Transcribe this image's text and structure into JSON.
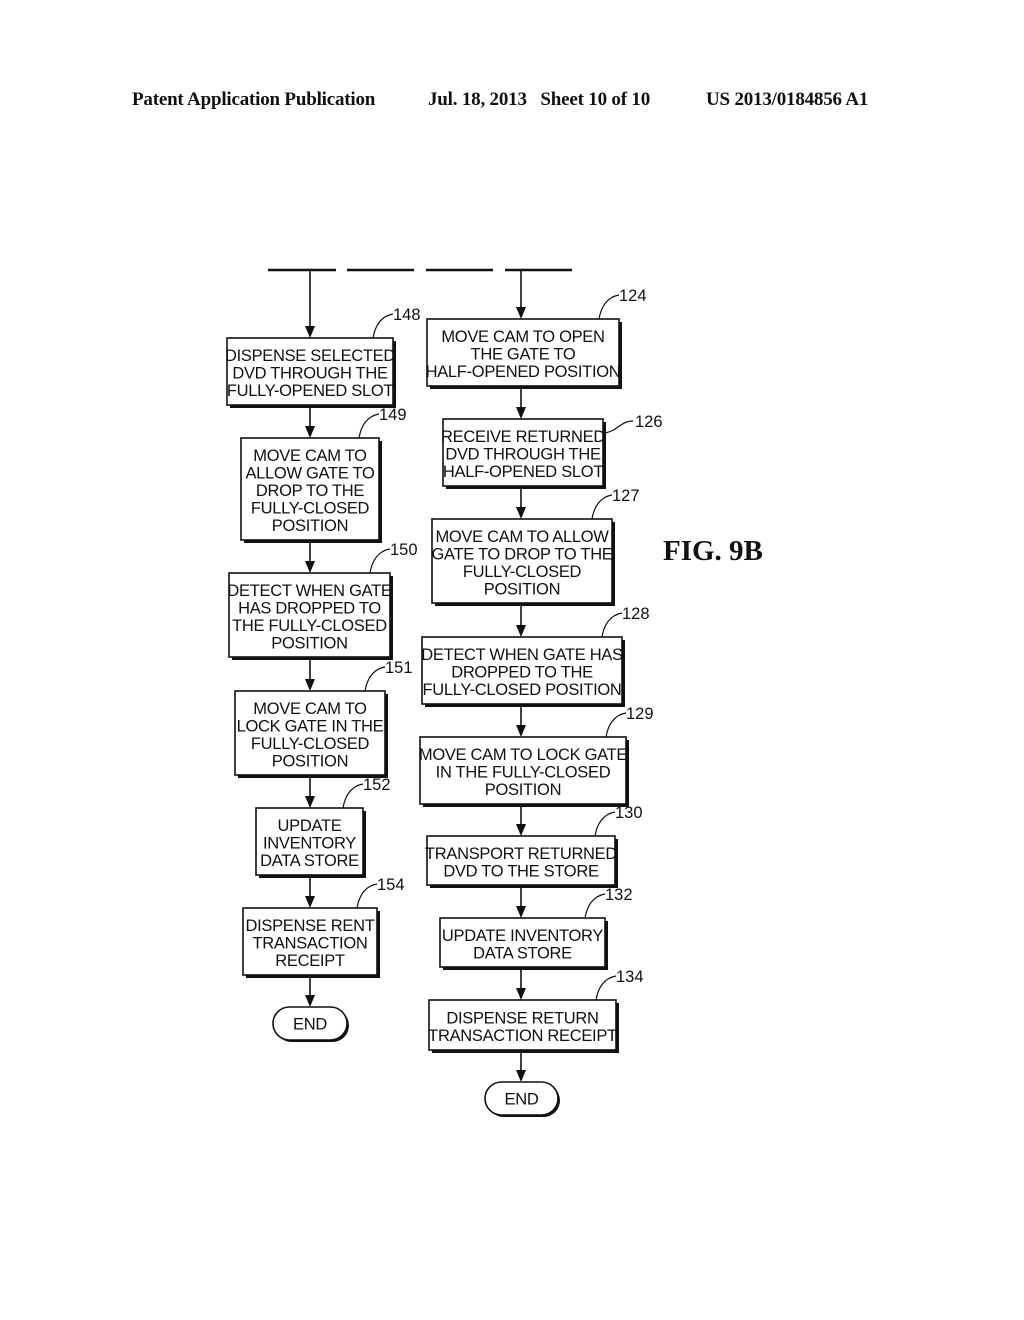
{
  "header": {
    "publication": "Patent Application Publication",
    "date_sheet": "Jul. 18, 2013   Sheet 10 of 10",
    "patent_number": "US 2013/0184856 A1"
  },
  "figure": {
    "label": "FIG. 9B"
  },
  "flowchart": {
    "left_column": {
      "steps": [
        {
          "ref": "148",
          "lines": [
            "DISPENSE SELECTED",
            "DVD THROUGH THE",
            "FULLY-OPENED SLOT"
          ]
        },
        {
          "ref": "149",
          "lines": [
            "MOVE CAM TO",
            "ALLOW GATE TO",
            "DROP TO THE",
            "FULLY-CLOSED",
            "POSITION"
          ]
        },
        {
          "ref": "150",
          "lines": [
            "DETECT WHEN GATE",
            "HAS DROPPED TO",
            "THE FULLY-CLOSED",
            "POSITION"
          ]
        },
        {
          "ref": "151",
          "lines": [
            "MOVE CAM TO",
            "LOCK GATE IN THE",
            "FULLY-CLOSED",
            "POSITION"
          ]
        },
        {
          "ref": "152",
          "lines": [
            "UPDATE",
            "INVENTORY",
            "DATA STORE"
          ]
        },
        {
          "ref": "154",
          "lines": [
            "DISPENSE RENT",
            "TRANSACTION",
            "RECEIPT"
          ]
        }
      ],
      "terminal": "END"
    },
    "right_column": {
      "steps": [
        {
          "ref": "124",
          "lines": [
            "MOVE CAM TO OPEN",
            "THE GATE TO",
            "HALF-OPENED POSITION"
          ]
        },
        {
          "ref": "126",
          "lines": [
            "RECEIVE RETURNED",
            "DVD THROUGH THE",
            "HALF-OPENED SLOT"
          ]
        },
        {
          "ref": "127",
          "lines": [
            "MOVE CAM TO ALLOW",
            "GATE TO DROP TO THE",
            "FULLY-CLOSED",
            "POSITION"
          ]
        },
        {
          "ref": "128",
          "lines": [
            "DETECT WHEN GATE HAS",
            "DROPPED TO THE",
            "FULLY-CLOSED POSITION"
          ]
        },
        {
          "ref": "129",
          "lines": [
            "MOVE CAM TO LOCK GATE",
            "IN THE FULLY-CLOSED",
            "POSITION"
          ]
        },
        {
          "ref": "130",
          "lines": [
            "TRANSPORT RETURNED",
            "DVD TO THE STORE"
          ]
        },
        {
          "ref": "132",
          "lines": [
            "UPDATE INVENTORY",
            "DATA STORE"
          ]
        },
        {
          "ref": "134",
          "lines": [
            "DISPENSE RETURN",
            "TRANSACTION RECEIPT"
          ]
        }
      ],
      "terminal": "END"
    }
  }
}
